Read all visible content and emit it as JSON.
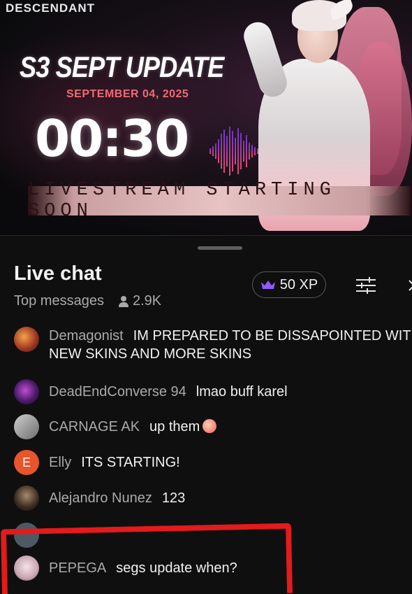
{
  "video": {
    "brand": "DESCENDANT",
    "update_title": "S3 SEPT UPDATE",
    "update_date": "SEPTEMBER 04, 2025",
    "countdown": "00:30",
    "stream_status": "LIVESTREAM STARTING SOON"
  },
  "chat": {
    "title": "Live chat",
    "filter_label": "Top messages",
    "viewer_count": "2.9K",
    "xp_label": "50 XP",
    "icons": [
      "crown-icon",
      "person-icon",
      "settings-sliders-icon",
      "close-icon"
    ],
    "colors": {
      "accent_purple": "#8c5cff",
      "annotation_red": "#e31b1b",
      "elly_avatar": "#e8542b"
    },
    "messages": [
      {
        "author": "Demagonist",
        "text": "IM PREPARED TO BE DISSAPOINTED WITH NEW SKINS AND MORE SKINS"
      },
      {
        "author": "DeadEndConverse 94",
        "text": "lmao buff karel"
      },
      {
        "author": "CARNAGE AK",
        "text": "up them"
      },
      {
        "author": "Elly",
        "avatar_letter": "E",
        "text": "ITS STARTING!"
      },
      {
        "author": "Alejandro Nunez",
        "text": "123"
      },
      {
        "author": "PEPEGA",
        "text": "segs update when?"
      }
    ]
  }
}
